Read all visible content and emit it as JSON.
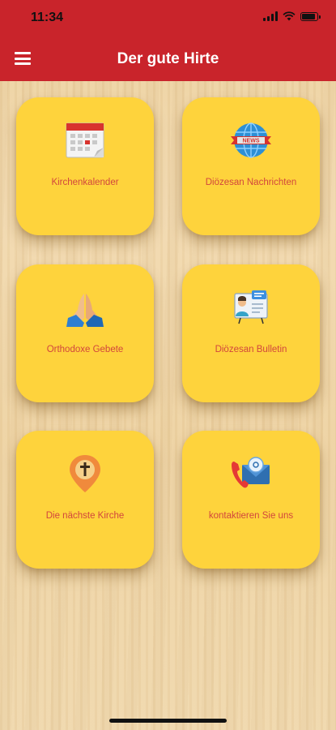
{
  "status_bar": {
    "time": "11:34",
    "battery_level": 0.9
  },
  "app": {
    "title": "Der gute Hirte",
    "accent_color": "#c9242b",
    "tile_color": "#fed33c",
    "label_color": "#d2463c"
  },
  "tiles": [
    {
      "label": "Kirchenkalender",
      "icon": "calendar-icon"
    },
    {
      "label": "Diözesan Nachrichten",
      "icon": "news-globe-icon"
    },
    {
      "label": "Orthodoxe Gebete",
      "icon": "praying-hands-icon"
    },
    {
      "label": "Diözesan Bulletin",
      "icon": "bulletin-board-icon"
    },
    {
      "label": "Die nächste Kirche",
      "icon": "church-location-pin-icon"
    },
    {
      "label": "kontaktieren Sie uns",
      "icon": "contact-phone-mail-icon"
    }
  ]
}
